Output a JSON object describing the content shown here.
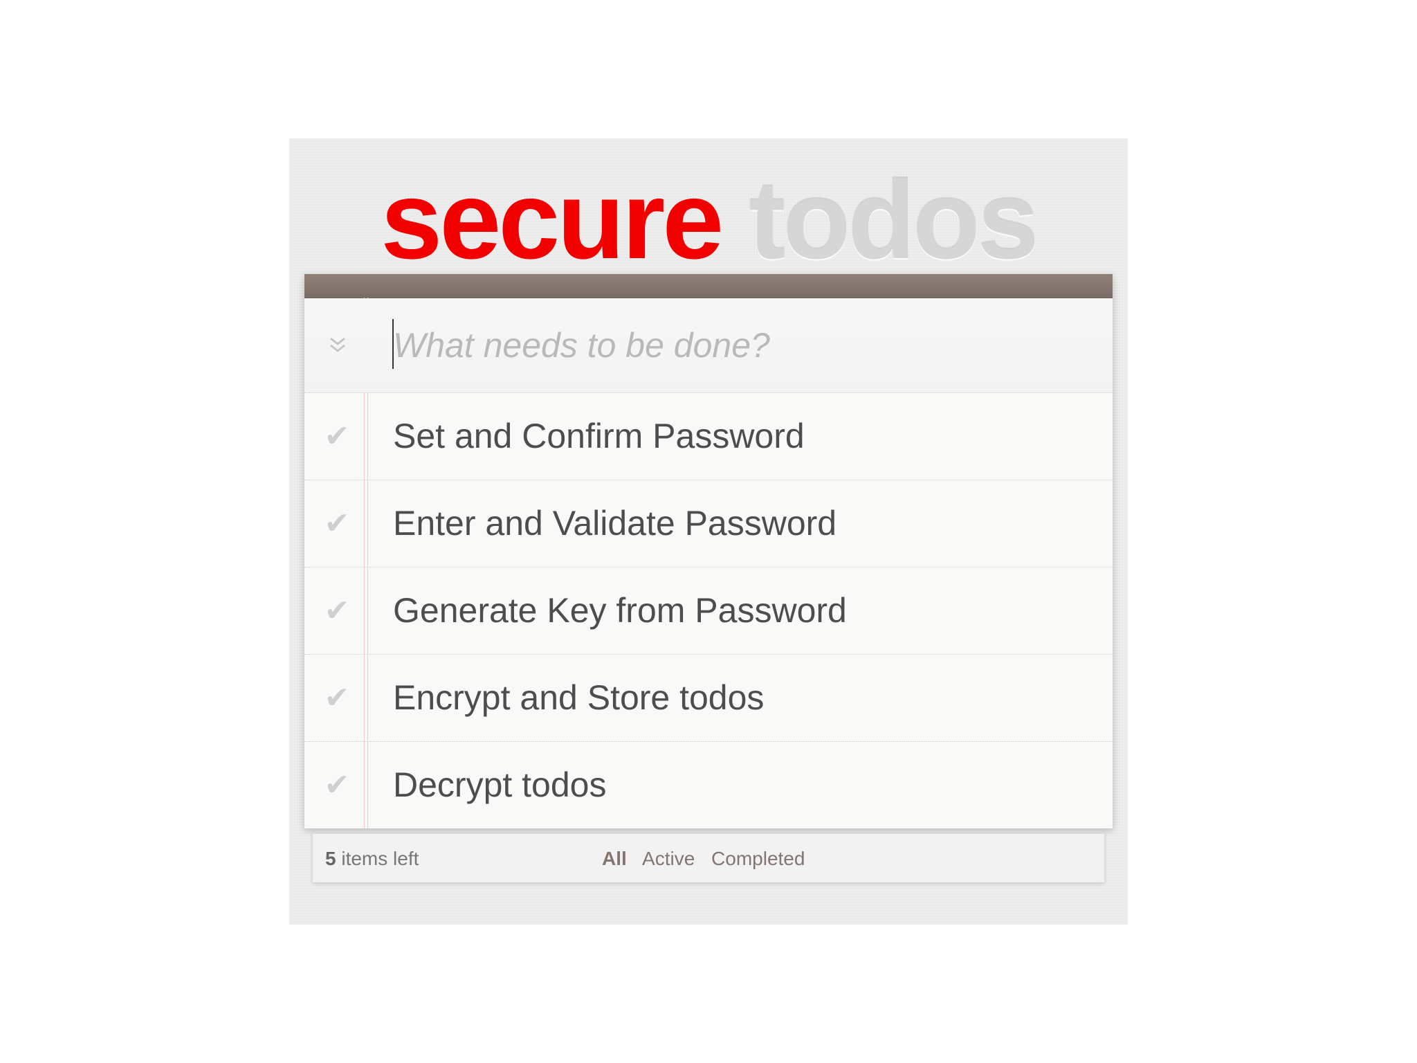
{
  "header": {
    "title_primary": "secure",
    "title_secondary": "todos"
  },
  "new_todo": {
    "placeholder": "What needs to be done?",
    "value": "",
    "toggle_all_icon": "double-chevron-down-icon"
  },
  "todos": [
    {
      "label": "Set and Confirm Password",
      "completed": false
    },
    {
      "label": "Enter and Validate Password",
      "completed": false
    },
    {
      "label": "Generate Key from Password",
      "completed": false
    },
    {
      "label": "Encrypt and Store todos",
      "completed": false
    },
    {
      "label": "Decrypt todos",
      "completed": false
    }
  ],
  "footer": {
    "count": "5",
    "count_suffix": " items left",
    "filters": [
      "All",
      "Active",
      "Completed"
    ],
    "selected_filter": "All"
  },
  "colors": {
    "title_primary": "#f20000",
    "title_secondary": "#d6d6d6",
    "topbar": "#857770",
    "filter_link": "#83756f"
  }
}
